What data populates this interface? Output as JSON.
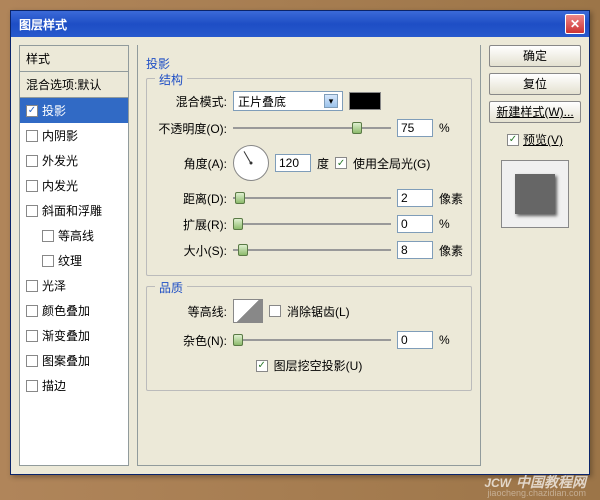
{
  "window": {
    "title": "图层样式"
  },
  "styles": {
    "header": "样式",
    "blend_defaults": "混合选项:默认",
    "items": [
      {
        "label": "投影",
        "checked": true,
        "selected": true
      },
      {
        "label": "内阴影",
        "checked": false
      },
      {
        "label": "外发光",
        "checked": false
      },
      {
        "label": "内发光",
        "checked": false
      },
      {
        "label": "斜面和浮雕",
        "checked": false
      },
      {
        "label": "等高线",
        "checked": false,
        "indent": true
      },
      {
        "label": "纹理",
        "checked": false,
        "indent": true
      },
      {
        "label": "光泽",
        "checked": false
      },
      {
        "label": "颜色叠加",
        "checked": false
      },
      {
        "label": "渐变叠加",
        "checked": false
      },
      {
        "label": "图案叠加",
        "checked": false
      },
      {
        "label": "描边",
        "checked": false
      }
    ]
  },
  "settings": {
    "title": "投影",
    "structure": {
      "legend": "结构",
      "blend_mode_label": "混合模式:",
      "blend_mode_value": "正片叠底",
      "opacity_label": "不透明度(O):",
      "opacity_value": "75",
      "opacity_unit": "%",
      "angle_label": "角度(A):",
      "angle_value": "120",
      "angle_unit": "度",
      "global_light": "使用全局光(G)",
      "distance_label": "距离(D):",
      "distance_value": "2",
      "distance_unit": "像素",
      "spread_label": "扩展(R):",
      "spread_value": "0",
      "spread_unit": "%",
      "size_label": "大小(S):",
      "size_value": "8",
      "size_unit": "像素"
    },
    "quality": {
      "legend": "品质",
      "contour_label": "等高线:",
      "antialias": "消除锯齿(L)",
      "noise_label": "杂色(N):",
      "noise_value": "0",
      "noise_unit": "%",
      "knockout": "图层挖空投影(U)"
    }
  },
  "buttons": {
    "ok": "确定",
    "cancel": "复位",
    "new_style": "新建样式(W)...",
    "preview": "预览(V)"
  },
  "watermark": {
    "main": "JCW",
    "sub": "jiaocheng.chazidian.com",
    "cn": "中国教程网"
  }
}
